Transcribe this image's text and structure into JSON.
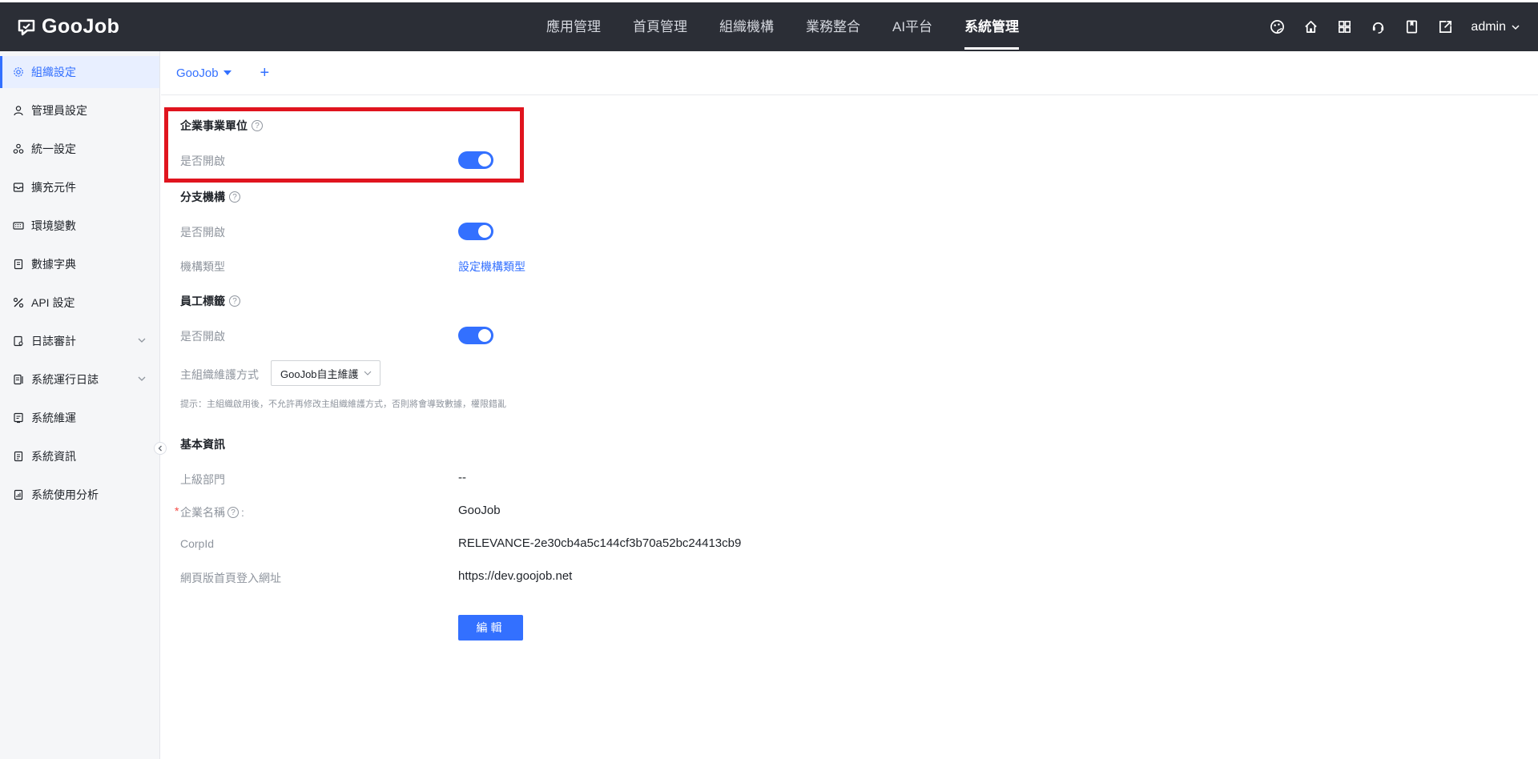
{
  "app": {
    "logo_text": "GooJob"
  },
  "topnav": {
    "items": [
      "應用管理",
      "首頁管理",
      "組織機構",
      "業務整合",
      "AI平台",
      "系統管理"
    ],
    "active": "系統管理"
  },
  "user": {
    "name": "admin"
  },
  "sidebar": {
    "items": [
      {
        "label": "組織設定",
        "icon": "gear-icon"
      },
      {
        "label": "管理員設定",
        "icon": "user-icon"
      },
      {
        "label": "統一設定",
        "icon": "recycle-icon"
      },
      {
        "label": "擴充元件",
        "icon": "inbox-icon"
      },
      {
        "label": "環境變數",
        "icon": "keyboard-icon"
      },
      {
        "label": "數據字典",
        "icon": "book-icon"
      },
      {
        "label": "API 設定",
        "icon": "api-icon"
      },
      {
        "label": "日誌審計",
        "icon": "audit-icon"
      },
      {
        "label": "系統運行日誌",
        "icon": "log-icon"
      },
      {
        "label": "系統維運",
        "icon": "maintenance-icon"
      },
      {
        "label": "系統資訊",
        "icon": "info-doc-icon"
      },
      {
        "label": "系統使用分析",
        "icon": "analysis-icon"
      }
    ]
  },
  "tabs": {
    "current": "GooJob",
    "add_label": "+"
  },
  "sections": {
    "enterprise_unit": {
      "title": "企業事業單位",
      "enabled_label": "是否開啟",
      "enabled": true
    },
    "branch": {
      "title": "分支機構",
      "enabled_label": "是否開啟",
      "enabled": true,
      "type_label": "機構類型",
      "type_link": "設定機構類型"
    },
    "employee_tag": {
      "title": "員工標籤",
      "enabled_label": "是否開啟",
      "enabled": true
    },
    "maintain": {
      "label": "主組織維護方式",
      "value": "GooJob自主維護",
      "hint": "提示：主組織啟用後，不允許再修改主組織維護方式，否則將會導致數據，權限錯亂"
    },
    "basic": {
      "title": "基本資訊",
      "fields": [
        {
          "label": "上級部門",
          "value": "--"
        },
        {
          "label": "企業名稱",
          "value": "GooJob"
        },
        {
          "label": "CorpId",
          "value": "RELEVANCE-2e30cb4a5c144cf3b70a52bc24413cb9"
        },
        {
          "label": "網頁版首頁登入網址",
          "value": "https://dev.goojob.net"
        }
      ],
      "name_suffix": ":",
      "required_mark": "*"
    },
    "edit_button": "編輯"
  },
  "help_glyph": "?",
  "colors": {
    "accent": "#3370ff",
    "topbar": "#2b2e36",
    "highlight": "#e0141e"
  }
}
